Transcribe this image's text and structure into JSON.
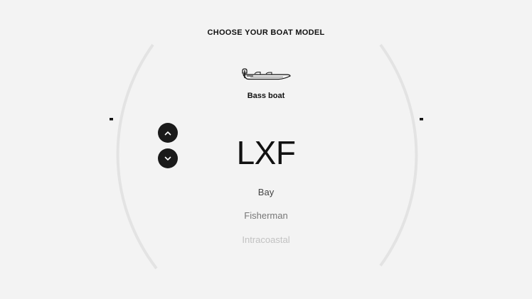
{
  "page": {
    "heading": "CHOOSE YOUR BOAT MODEL",
    "category_label": "Bass boat",
    "boat_icon": "bass-boat-icon"
  },
  "carousel": {
    "up_icon": "chevron-up-icon",
    "down_icon": "chevron-down-icon",
    "current_model": "LXF",
    "upcoming_models": [
      "Bay",
      "Fisherman",
      "Intracoastal"
    ]
  },
  "colors": {
    "background": "#f3f3f3",
    "text": "#111111",
    "button": "#1a1a1a",
    "arc": "#e2e2e2"
  }
}
